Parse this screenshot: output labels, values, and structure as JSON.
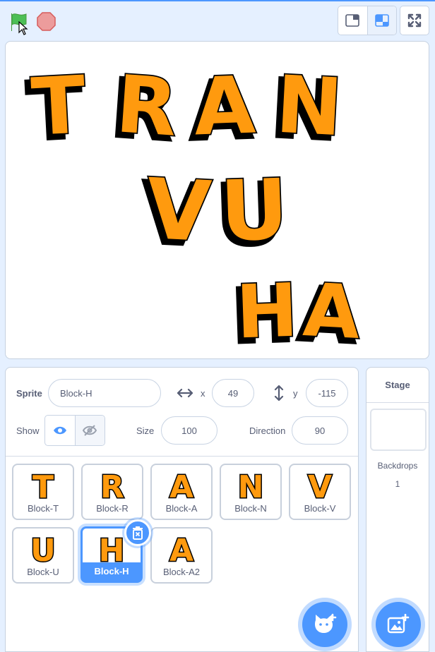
{
  "stage": {
    "row1": [
      "T",
      "R",
      "A",
      "N"
    ],
    "row2": [
      "V",
      "U"
    ],
    "row3": [
      "H",
      "A"
    ]
  },
  "sprite_info": {
    "sprite_label": "Sprite",
    "sprite_name": "Block-H",
    "x_label": "x",
    "x_value": "49",
    "y_label": "y",
    "y_value": "-115",
    "show_label": "Show",
    "size_label": "Size",
    "size_value": "100",
    "direction_label": "Direction",
    "direction_value": "90"
  },
  "sprites": [
    {
      "name": "Block-T",
      "letter": "T",
      "selected": false
    },
    {
      "name": "Block-R",
      "letter": "R",
      "selected": false
    },
    {
      "name": "Block-A",
      "letter": "A",
      "selected": false
    },
    {
      "name": "Block-N",
      "letter": "N",
      "selected": false
    },
    {
      "name": "Block-V",
      "letter": "V",
      "selected": false
    },
    {
      "name": "Block-U",
      "letter": "U",
      "selected": false
    },
    {
      "name": "Block-H",
      "letter": "H",
      "selected": true
    },
    {
      "name": "Block-A2",
      "letter": "A",
      "selected": false
    }
  ],
  "stage_panel": {
    "title": "Stage",
    "backdrops_label": "Backdrops",
    "backdrops_count": "1"
  },
  "icons": {
    "green_flag": "green-flag-icon",
    "stop": "stop-icon",
    "small_stage": "small-stage-icon",
    "large_stage": "large-stage-icon",
    "fullscreen": "fullscreen-icon",
    "delete": "trash-icon",
    "choose_sprite": "cat-plus-icon",
    "choose_backdrop": "image-plus-icon"
  },
  "colors": {
    "accent": "#4c97ff",
    "letter_fill": "#ff9a0e",
    "letter_shadow": "#000000",
    "flag": "#4cbf56",
    "stop": "#ec9c9c"
  }
}
